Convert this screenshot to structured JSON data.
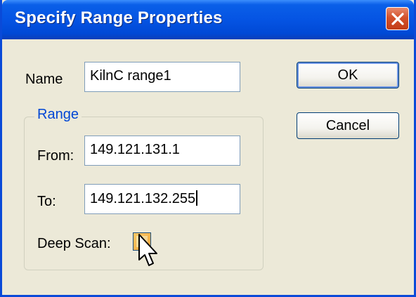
{
  "window": {
    "title": "Specify Range Properties",
    "close_icon": "close-icon"
  },
  "form": {
    "name_label": "Name",
    "name_value": "KilnC range1",
    "range_group_label": "Range",
    "from_label": "From:",
    "from_value": "149.121.131.1",
    "to_label": "To:",
    "to_value": "149.121.132.255",
    "deep_scan_label": "Deep Scan:",
    "deep_scan_checked": false
  },
  "buttons": {
    "ok_label": "OK",
    "cancel_label": "Cancel"
  },
  "colors": {
    "titlebar": "#0554e3",
    "close_button": "#d4512b",
    "group_label": "#0046d5",
    "dialog_background": "#ece9d8"
  }
}
